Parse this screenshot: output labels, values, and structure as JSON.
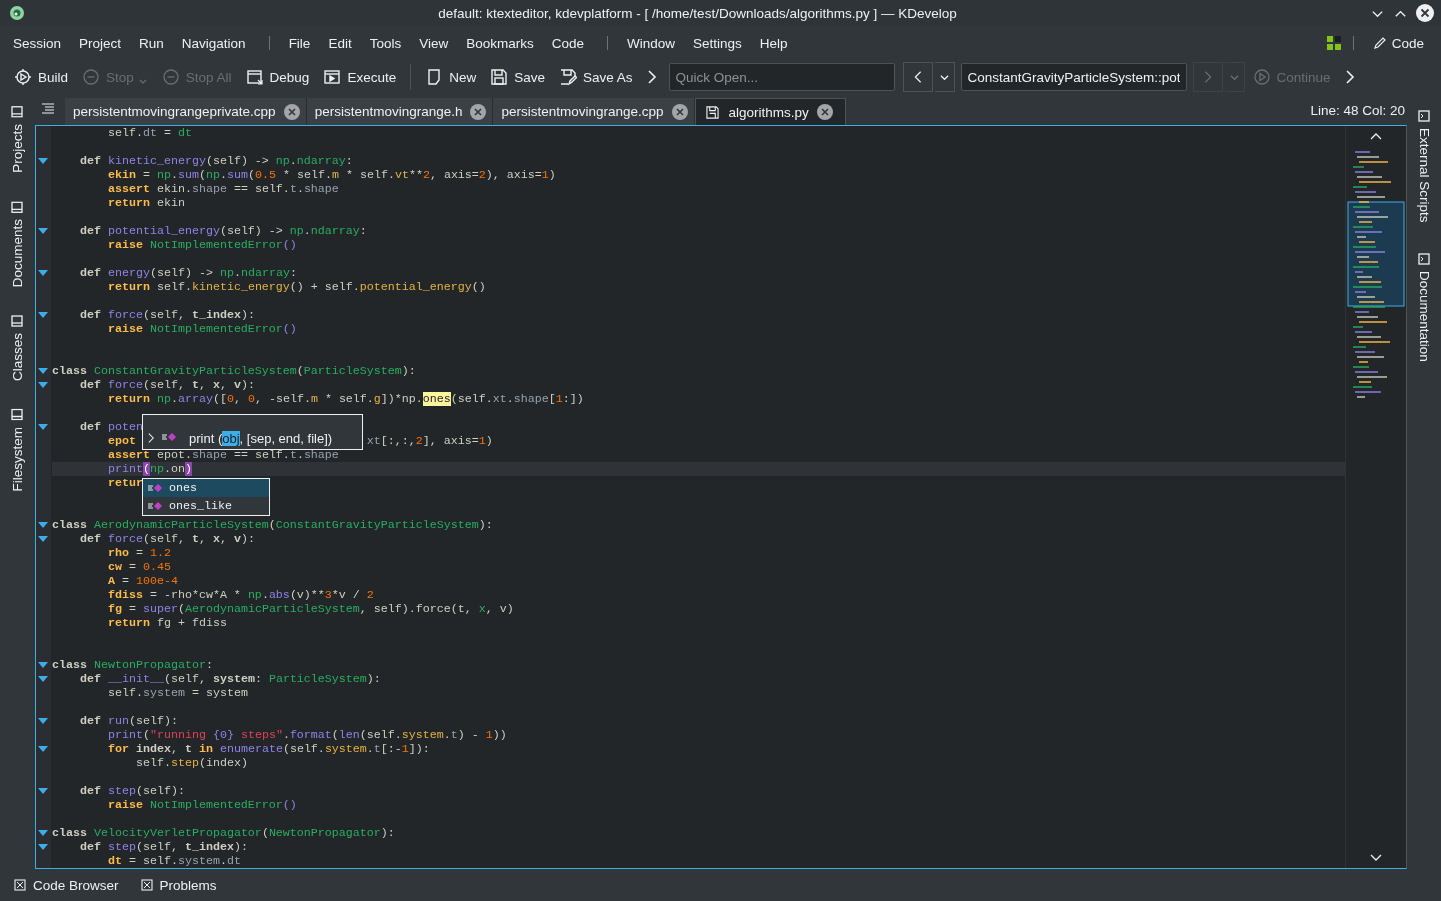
{
  "window": {
    "title": "default:  ktexteditor, kdevplatform - [ /home/test/Downloads/algorithms.py ] — KDevelop"
  },
  "menu": {
    "groups": [
      [
        "Session",
        "Project",
        "Run",
        "Navigation"
      ],
      [
        "File",
        "Edit",
        "Tools",
        "View",
        "Bookmarks",
        "Code"
      ],
      [
        "Window",
        "Settings",
        "Help"
      ]
    ],
    "area_button": "Code"
  },
  "toolbar": {
    "groups": [
      [
        {
          "kind": "build",
          "label": "Build",
          "disabled": false
        },
        {
          "kind": "stop",
          "label": "Stop",
          "disabled": true
        },
        {
          "kind": "stopall",
          "label": "Stop All",
          "disabled": true
        },
        {
          "kind": "debug",
          "label": "Debug",
          "disabled": false
        },
        {
          "kind": "execute",
          "label": "Execute",
          "disabled": false
        }
      ],
      [
        {
          "kind": "new",
          "label": "New",
          "disabled": false
        },
        {
          "kind": "save",
          "label": "Save",
          "disabled": false
        },
        {
          "kind": "saveas",
          "label": "Save As",
          "disabled": false
        },
        {
          "kind": "more"
        }
      ],
      [
        {
          "kind": "search",
          "placeholder": "Quick Open..."
        },
        {
          "kind": "back",
          "disabled": false
        },
        {
          "kind": "history",
          "disabled": false
        },
        {
          "kind": "location",
          "value": "ConstantGravityParticleSystem::pot"
        },
        {
          "kind": "forward",
          "disabled": true
        },
        {
          "kind": "history",
          "disabled": true
        },
        {
          "kind": "continue",
          "label": "Continue",
          "disabled": true
        },
        {
          "kind": "more"
        }
      ]
    ]
  },
  "left_dock": [
    "Projects",
    "Documents",
    "Classes",
    "Filesystem"
  ],
  "right_dock": [
    "External Scripts",
    "Documentation"
  ],
  "tabs": [
    {
      "label": "persistentmovingrangeprivate.cpp",
      "selected": false
    },
    {
      "label": "persistentmovingrange.h",
      "selected": false
    },
    {
      "label": "persistentmovingrange.cpp",
      "selected": false
    },
    {
      "label": "algorithms.py",
      "selected": true
    }
  ],
  "cursor_position": "Line: 48 Col: 20",
  "editor": {
    "lines": [
      {
        "fold": false,
        "tokens": [
          {
            "kind": "plain",
            "text": "        self."
          },
          {
            "kind": "attr",
            "text": "dt"
          },
          {
            "kind": "plain",
            "text": " = "
          },
          {
            "kind": "type",
            "text": "dt"
          }
        ]
      },
      {
        "fold": false
      },
      {
        "fold": true,
        "tokens": [
          {
            "kind": "decl",
            "text": "    def "
          },
          {
            "kind": "func",
            "text": "kinetic_energy"
          },
          {
            "kind": "plain",
            "text": "(self) -> "
          },
          {
            "kind": "type",
            "text": "np"
          },
          {
            "kind": "plain",
            "text": "."
          },
          {
            "kind": "type",
            "text": "ndarray"
          },
          {
            "kind": "plain",
            "text": ":"
          }
        ]
      },
      {
        "fold": false,
        "tokens": [
          {
            "kind": "var",
            "text": "        ekin"
          },
          {
            "kind": "plain",
            "text": " = "
          },
          {
            "kind": "type",
            "text": "np"
          },
          {
            "kind": "plain",
            "text": "."
          },
          {
            "kind": "func",
            "text": "sum"
          },
          {
            "kind": "plain",
            "text": "("
          },
          {
            "kind": "type",
            "text": "np"
          },
          {
            "kind": "plain",
            "text": "."
          },
          {
            "kind": "func",
            "text": "sum"
          },
          {
            "kind": "plain",
            "text": "("
          },
          {
            "kind": "number",
            "text": "0.5"
          },
          {
            "kind": "plain",
            "text": " * self."
          },
          {
            "kind": "member",
            "text": "m"
          },
          {
            "kind": "plain",
            "text": " * self."
          },
          {
            "kind": "member",
            "text": "vt"
          },
          {
            "kind": "plain",
            "text": "**"
          },
          {
            "kind": "number",
            "text": "2"
          },
          {
            "kind": "plain",
            "text": ", axis="
          },
          {
            "kind": "number",
            "text": "2"
          },
          {
            "kind": "plain",
            "text": "), axis="
          },
          {
            "kind": "number",
            "text": "1"
          },
          {
            "kind": "plain",
            "text": ")"
          }
        ]
      },
      {
        "fold": false,
        "tokens": [
          {
            "kind": "keyword",
            "text": "        assert "
          },
          {
            "kind": "plain",
            "text": "ekin."
          },
          {
            "kind": "attr",
            "text": "shape"
          },
          {
            "kind": "plain",
            "text": " == self."
          },
          {
            "kind": "attr",
            "text": "t"
          },
          {
            "kind": "plain",
            "text": "."
          },
          {
            "kind": "attr",
            "text": "shape"
          }
        ]
      },
      {
        "fold": false,
        "tokens": [
          {
            "kind": "keyword",
            "text": "        return "
          },
          {
            "kind": "plain",
            "text": "ekin"
          }
        ]
      },
      {
        "fold": false
      },
      {
        "fold": true,
        "tokens": [
          {
            "kind": "decl",
            "text": "    def "
          },
          {
            "kind": "func",
            "text": "potential_energy"
          },
          {
            "kind": "plain",
            "text": "(self) -> "
          },
          {
            "kind": "type",
            "text": "np"
          },
          {
            "kind": "plain",
            "text": "."
          },
          {
            "kind": "type",
            "text": "ndarray"
          },
          {
            "kind": "plain",
            "text": ":"
          }
        ]
      },
      {
        "fold": false,
        "tokens": [
          {
            "kind": "keyword",
            "text": "        raise "
          },
          {
            "kind": "type",
            "text": "NotImplementedError"
          },
          {
            "kind": "func",
            "text": "()"
          }
        ]
      },
      {
        "fold": false
      },
      {
        "fold": true,
        "tokens": [
          {
            "kind": "decl",
            "text": "    def "
          },
          {
            "kind": "func",
            "text": "energy"
          },
          {
            "kind": "plain",
            "text": "(self) -> "
          },
          {
            "kind": "type",
            "text": "np"
          },
          {
            "kind": "plain",
            "text": "."
          },
          {
            "kind": "type",
            "text": "ndarray"
          },
          {
            "kind": "plain",
            "text": ":"
          }
        ]
      },
      {
        "fold": false,
        "tokens": [
          {
            "kind": "keyword",
            "text": "        return "
          },
          {
            "kind": "plain",
            "text": "self."
          },
          {
            "kind": "member",
            "text": "kinetic_energy"
          },
          {
            "kind": "plain",
            "text": "() + self."
          },
          {
            "kind": "member",
            "text": "potential_energy"
          },
          {
            "kind": "plain",
            "text": "()"
          }
        ]
      },
      {
        "fold": false
      },
      {
        "fold": true,
        "tokens": [
          {
            "kind": "decl",
            "text": "    def "
          },
          {
            "kind": "func",
            "text": "force"
          },
          {
            "kind": "plain",
            "text": "(self, "
          },
          {
            "kind": "decl",
            "text": "t_index"
          },
          {
            "kind": "plain",
            "text": "):"
          }
        ]
      },
      {
        "fold": false,
        "tokens": [
          {
            "kind": "keyword",
            "text": "        raise "
          },
          {
            "kind": "type",
            "text": "NotImplementedError"
          },
          {
            "kind": "func",
            "text": "()"
          }
        ]
      },
      {
        "fold": false
      },
      {
        "fold": false
      },
      {
        "fold": true,
        "tokens": [
          {
            "kind": "decl",
            "text": "class "
          },
          {
            "kind": "type",
            "text": "ConstantGravityParticleSystem"
          },
          {
            "kind": "plain",
            "text": "("
          },
          {
            "kind": "type",
            "text": "ParticleSystem"
          },
          {
            "kind": "plain",
            "text": "):"
          }
        ]
      },
      {
        "fold": true,
        "tokens": [
          {
            "kind": "decl",
            "text": "    def "
          },
          {
            "kind": "func",
            "text": "force"
          },
          {
            "kind": "plain",
            "text": "(self, "
          },
          {
            "kind": "decl",
            "text": "t"
          },
          {
            "kind": "plain",
            "text": ", "
          },
          {
            "kind": "decl",
            "text": "x"
          },
          {
            "kind": "plain",
            "text": ", "
          },
          {
            "kind": "decl",
            "text": "v"
          },
          {
            "kind": "plain",
            "text": "):"
          }
        ]
      },
      {
        "fold": false,
        "tokens": [
          {
            "kind": "keyword",
            "text": "        return "
          },
          {
            "kind": "type",
            "text": "np"
          },
          {
            "kind": "plain",
            "text": "."
          },
          {
            "kind": "func",
            "text": "array"
          },
          {
            "kind": "plain",
            "text": "(["
          },
          {
            "kind": "number",
            "text": "0"
          },
          {
            "kind": "plain",
            "text": ", "
          },
          {
            "kind": "number",
            "text": "0"
          },
          {
            "kind": "plain",
            "text": ", -self."
          },
          {
            "kind": "member",
            "text": "m"
          },
          {
            "kind": "plain",
            "text": " * self."
          },
          {
            "kind": "member",
            "text": "g"
          },
          {
            "kind": "plain",
            "text": "])*np."
          },
          {
            "kind": "match",
            "text": "ones"
          },
          {
            "kind": "plain",
            "text": "(self."
          },
          {
            "kind": "attr",
            "text": "xt"
          },
          {
            "kind": "plain",
            "text": "."
          },
          {
            "kind": "attr",
            "text": "shape"
          },
          {
            "kind": "plain",
            "text": "["
          },
          {
            "kind": "number",
            "text": "1"
          },
          {
            "kind": "plain",
            "text": ":])"
          }
        ]
      },
      {
        "fold": false
      },
      {
        "fold": true,
        "tokens": [
          {
            "kind": "decl",
            "text": "    def "
          },
          {
            "kind": "func",
            "text": "poten"
          }
        ]
      },
      {
        "fold": false,
        "tokens": [
          {
            "kind": "var",
            "text": "        epot"
          }
        ],
        "tail": [
          {
            "kind": "attr",
            "text": "xt"
          },
          {
            "kind": "plain",
            "text": "[:,:,"
          },
          {
            "kind": "number",
            "text": "2"
          },
          {
            "kind": "plain",
            "text": "], axis="
          },
          {
            "kind": "number",
            "text": "1"
          },
          {
            "kind": "plain",
            "text": ")"
          }
        ]
      },
      {
        "fold": false,
        "tokens": [
          {
            "kind": "keyword",
            "text": "        assert "
          },
          {
            "kind": "plain",
            "text": "epot."
          },
          {
            "kind": "attr",
            "text": "shape"
          },
          {
            "kind": "plain",
            "text": " == self."
          },
          {
            "kind": "attr",
            "text": "t"
          },
          {
            "kind": "plain",
            "text": "."
          },
          {
            "kind": "attr",
            "text": "shape"
          }
        ]
      },
      {
        "fold": false,
        "current": true,
        "tokens": [
          {
            "kind": "func",
            "text": "        print"
          },
          {
            "kind": "bracket",
            "text": "("
          },
          {
            "kind": "type",
            "text": "np"
          },
          {
            "kind": "plain",
            "text": ".on"
          },
          {
            "kind": "bracket",
            "text": ")"
          }
        ]
      },
      {
        "fold": false,
        "tokens": [
          {
            "kind": "keyword",
            "text": "        retur"
          }
        ]
      },
      {
        "fold": false
      },
      {
        "fold": false
      },
      {
        "fold": true,
        "tokens": [
          {
            "kind": "decl",
            "text": "class "
          },
          {
            "kind": "type",
            "text": "AerodynamicParticleSystem"
          },
          {
            "kind": "plain",
            "text": "("
          },
          {
            "kind": "type",
            "text": "ConstantGravityParticleSystem"
          },
          {
            "kind": "plain",
            "text": "):"
          }
        ]
      },
      {
        "fold": true,
        "tokens": [
          {
            "kind": "decl",
            "text": "    def "
          },
          {
            "kind": "func",
            "text": "force"
          },
          {
            "kind": "plain",
            "text": "(self, "
          },
          {
            "kind": "decl",
            "text": "t"
          },
          {
            "kind": "plain",
            "text": ", "
          },
          {
            "kind": "decl",
            "text": "x"
          },
          {
            "kind": "plain",
            "text": ", "
          },
          {
            "kind": "decl",
            "text": "v"
          },
          {
            "kind": "plain",
            "text": "):"
          }
        ]
      },
      {
        "fold": false,
        "tokens": [
          {
            "kind": "var",
            "text": "        rho"
          },
          {
            "kind": "plain",
            "text": " = "
          },
          {
            "kind": "number",
            "text": "1.2"
          }
        ]
      },
      {
        "fold": false,
        "tokens": [
          {
            "kind": "var",
            "text": "        cw"
          },
          {
            "kind": "plain",
            "text": " = "
          },
          {
            "kind": "number",
            "text": "0.45"
          }
        ]
      },
      {
        "fold": false,
        "tokens": [
          {
            "kind": "var",
            "text": "        A"
          },
          {
            "kind": "plain",
            "text": " = "
          },
          {
            "kind": "number",
            "text": "100e-4"
          }
        ]
      },
      {
        "fold": false,
        "tokens": [
          {
            "kind": "var",
            "text": "        fdiss"
          },
          {
            "kind": "plain",
            "text": " = -rho*cw*A * "
          },
          {
            "kind": "type",
            "text": "np"
          },
          {
            "kind": "plain",
            "text": "."
          },
          {
            "kind": "func",
            "text": "abs"
          },
          {
            "kind": "plain",
            "text": "(v)**"
          },
          {
            "kind": "number",
            "text": "3"
          },
          {
            "kind": "plain",
            "text": "*v / "
          },
          {
            "kind": "number",
            "text": "2"
          }
        ]
      },
      {
        "fold": false,
        "tokens": [
          {
            "kind": "var",
            "text": "        fg"
          },
          {
            "kind": "plain",
            "text": " = "
          },
          {
            "kind": "func",
            "text": "super"
          },
          {
            "kind": "plain",
            "text": "("
          },
          {
            "kind": "type",
            "text": "AerodynamicParticleSystem"
          },
          {
            "kind": "plain",
            "text": ", self).force(t, "
          },
          {
            "kind": "type",
            "text": "x"
          },
          {
            "kind": "plain",
            "text": ", v)"
          }
        ]
      },
      {
        "fold": false,
        "tokens": [
          {
            "kind": "keyword",
            "text": "        return "
          },
          {
            "kind": "plain",
            "text": "fg + fdiss"
          }
        ]
      },
      {
        "fold": false
      },
      {
        "fold": false
      },
      {
        "fold": true,
        "tokens": [
          {
            "kind": "decl",
            "text": "class "
          },
          {
            "kind": "type",
            "text": "NewtonPropagator"
          },
          {
            "kind": "plain",
            "text": ":"
          }
        ]
      },
      {
        "fold": true,
        "tokens": [
          {
            "kind": "decl",
            "text": "    def "
          },
          {
            "kind": "func",
            "text": "__init__"
          },
          {
            "kind": "plain",
            "text": "(self, "
          },
          {
            "kind": "decl",
            "text": "system"
          },
          {
            "kind": "plain",
            "text": ": "
          },
          {
            "kind": "type",
            "text": "ParticleSystem"
          },
          {
            "kind": "plain",
            "text": "):"
          }
        ]
      },
      {
        "fold": false,
        "tokens": [
          {
            "kind": "plain",
            "text": "        self."
          },
          {
            "kind": "attr",
            "text": "system"
          },
          {
            "kind": "plain",
            "text": " = system"
          }
        ]
      },
      {
        "fold": false
      },
      {
        "fold": true,
        "tokens": [
          {
            "kind": "decl",
            "text": "    def "
          },
          {
            "kind": "func",
            "text": "run"
          },
          {
            "kind": "plain",
            "text": "(self):"
          }
        ]
      },
      {
        "fold": false,
        "tokens": [
          {
            "kind": "func",
            "text": "        print"
          },
          {
            "kind": "plain",
            "text": "("
          },
          {
            "kind": "string",
            "text": "\"running "
          },
          {
            "kind": "func",
            "text": "{0}"
          },
          {
            "kind": "string",
            "text": " steps\""
          },
          {
            "kind": "plain",
            "text": "."
          },
          {
            "kind": "func",
            "text": "format"
          },
          {
            "kind": "plain",
            "text": "("
          },
          {
            "kind": "func",
            "text": "len"
          },
          {
            "kind": "plain",
            "text": "(self."
          },
          {
            "kind": "member",
            "text": "system"
          },
          {
            "kind": "plain",
            "text": "."
          },
          {
            "kind": "attr",
            "text": "t"
          },
          {
            "kind": "plain",
            "text": ") - "
          },
          {
            "kind": "number",
            "text": "1"
          },
          {
            "kind": "plain",
            "text": "))"
          }
        ]
      },
      {
        "fold": true,
        "tokens": [
          {
            "kind": "keyword",
            "text": "        for "
          },
          {
            "kind": "decl",
            "text": "index"
          },
          {
            "kind": "plain",
            "text": ", "
          },
          {
            "kind": "decl",
            "text": "t"
          },
          {
            "kind": "keyword",
            "text": " in "
          },
          {
            "kind": "func",
            "text": "enumerate"
          },
          {
            "kind": "plain",
            "text": "(self."
          },
          {
            "kind": "member",
            "text": "system"
          },
          {
            "kind": "plain",
            "text": "."
          },
          {
            "kind": "attr",
            "text": "t"
          },
          {
            "kind": "plain",
            "text": "[:-"
          },
          {
            "kind": "number",
            "text": "1"
          },
          {
            "kind": "plain",
            "text": "]):"
          }
        ]
      },
      {
        "fold": false,
        "tokens": [
          {
            "kind": "plain",
            "text": "            self."
          },
          {
            "kind": "member",
            "text": "step"
          },
          {
            "kind": "plain",
            "text": "(index)"
          }
        ]
      },
      {
        "fold": false
      },
      {
        "fold": true,
        "tokens": [
          {
            "kind": "decl",
            "text": "    def "
          },
          {
            "kind": "func",
            "text": "step"
          },
          {
            "kind": "plain",
            "text": "(self):"
          }
        ]
      },
      {
        "fold": false,
        "tokens": [
          {
            "kind": "keyword",
            "text": "        raise "
          },
          {
            "kind": "type",
            "text": "NotImplementedError"
          },
          {
            "kind": "func",
            "text": "()"
          }
        ]
      },
      {
        "fold": false
      },
      {
        "fold": true,
        "tokens": [
          {
            "kind": "decl",
            "text": "class "
          },
          {
            "kind": "type",
            "text": "VelocityVerletPropagator"
          },
          {
            "kind": "plain",
            "text": "("
          },
          {
            "kind": "type",
            "text": "NewtonPropagator"
          },
          {
            "kind": "plain",
            "text": "):"
          }
        ]
      },
      {
        "fold": true,
        "tokens": [
          {
            "kind": "decl",
            "text": "    def "
          },
          {
            "kind": "func",
            "text": "step"
          },
          {
            "kind": "plain",
            "text": "(self, "
          },
          {
            "kind": "decl",
            "text": "t_index"
          },
          {
            "kind": "plain",
            "text": "):"
          }
        ]
      },
      {
        "fold": false,
        "tokens": [
          {
            "kind": "var",
            "text": "        dt"
          },
          {
            "kind": "plain",
            "text": " = self."
          },
          {
            "kind": "attr",
            "text": "system"
          },
          {
            "kind": "plain",
            "text": "."
          },
          {
            "kind": "attr",
            "text": "dt"
          }
        ]
      }
    ],
    "signature_hint": {
      "before": "print (",
      "current": "obj",
      "after": ", [sep, end, file])"
    },
    "completions": [
      {
        "label": "ones",
        "selected": true
      },
      {
        "label": "ones_like",
        "selected": false
      }
    ]
  },
  "tool_views": [
    "Code Browser",
    "Problems"
  ]
}
